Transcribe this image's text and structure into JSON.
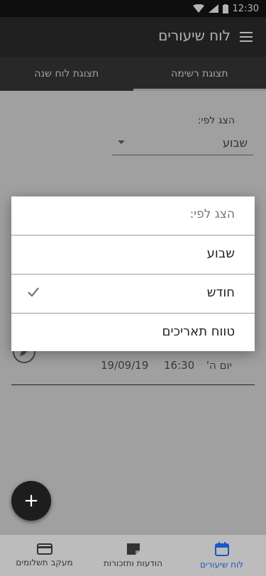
{
  "status_bar": {
    "time": "12:30"
  },
  "app_bar": {
    "title": "לוח שיעורים"
  },
  "tabs": [
    {
      "label": "תצוגת לוח שנה",
      "active": false
    },
    {
      "label": "תצוגת רשימה",
      "active": true
    }
  ],
  "filter": {
    "label": "הצג לפי:",
    "value": "שבוע"
  },
  "lesson": {
    "day": "יום ה'",
    "time": "16:30",
    "date": "19/09/19"
  },
  "popup": {
    "header": "הצג לפי:",
    "options": [
      {
        "label": "שבוע",
        "selected": false
      },
      {
        "label": "חודש",
        "selected": true
      },
      {
        "label": "טווח תאריכים",
        "selected": false
      }
    ]
  },
  "fab": {
    "icon": "add-icon"
  },
  "bottom_nav": [
    {
      "label": "מעקב תשלומים",
      "icon": "credit-card-icon",
      "active": false
    },
    {
      "label": "הודעות ותזכורות",
      "icon": "note-icon",
      "active": false
    },
    {
      "label": "לוח שיעורים",
      "icon": "calendar-icon",
      "active": true
    }
  ],
  "colors": {
    "accent": "#1c57c4",
    "appbar": "#2f2f2f"
  }
}
